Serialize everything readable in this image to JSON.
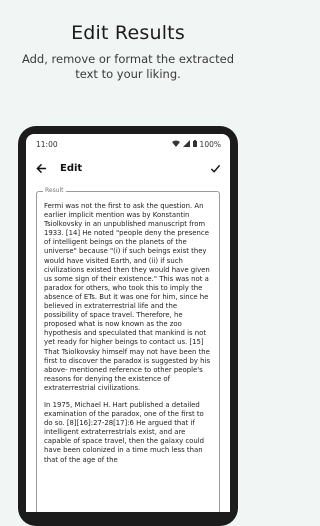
{
  "promo": {
    "headline": "Edit Results",
    "subline": "Add, remove or format the extracted text to your liking."
  },
  "status_bar": {
    "time": "11:00",
    "battery": "100%",
    "icons": [
      "wifi-icon",
      "signal-icon",
      "battery-icon"
    ]
  },
  "app_bar": {
    "back_icon": "arrow-back-icon",
    "title": "Edit",
    "confirm_icon": "check-icon"
  },
  "result_field": {
    "label": "Result",
    "paragraphs": [
      "Fermi was not the first to ask the question. An earlier implicit mention was by Konstantin Tsiolkovsky in an unpublished manuscript from 1933. [14] He noted \"people deny the presence of intelligent beings on the planets of the universe\" because \"(i) if such beings exist they would have visited Earth, and (ii) if such civilizations existed then they would have given us some sign of their existence.\" This was not a paradox for others, who took this to imply the absence of ETs. But it was one for him, since he believed in extraterrestrial life and the possibility of space travel. Therefore, he proposed what is now known as the zoo hypothesis and speculated that mankind is not yet ready for higher beings to contact us. [15] That Tsiolkovsky himself may not have been the first to discover the paradox is suggested by his above- mentioned reference to other people's reasons for denying the existence of extraterrestrial civilizations.",
      "In 1975, Michael H. Hart published a detailed examination of the paradox, one of the first to do so. [8][16]:27-28[17]:6 He argued that if intelligent extraterrestrials exist, and are capable of space travel, then the galaxy could have been colonized in a time much less than that of the age of the"
    ]
  },
  "colors": {
    "background": "#f1f6f4",
    "phone_frame": "#1c1c1c",
    "screen": "#ffffff"
  }
}
